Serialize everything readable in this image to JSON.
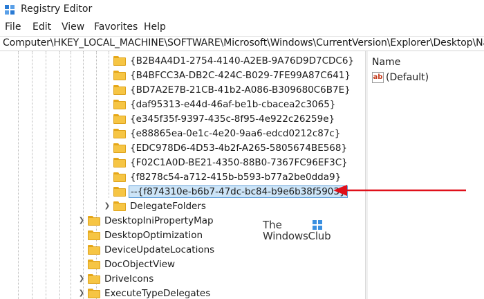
{
  "window": {
    "title": "Registry Editor"
  },
  "menu": [
    "File",
    "Edit",
    "View",
    "Favorites",
    "Help"
  ],
  "address": "Computer\\HKEY_LOCAL_MACHINE\\SOFTWARE\\Microsoft\\Windows\\CurrentVersion\\Explorer\\Desktop\\NameSpace",
  "tree": {
    "subkeys": [
      "{B2B4A4D1-2754-4140-A2EB-9A76D9D7CDC6}",
      "{B4BFCC3A-DB2C-424C-B029-7FE99A87C641}",
      "{BD7A2E7B-21CB-41b2-A086-B309680C6B7E}",
      "{daf95313-e44d-46af-be1b-cbacea2c3065}",
      "{e345f35f-9397-435c-8f95-4e922c26259e}",
      "{e88865ea-0e1c-4e20-9aa6-edcd0212c87c}",
      "{EDC978D6-4D53-4b2f-A265-5805674BE568}",
      "{F02C1A0D-BE21-4350-88B0-7367FC96EF3C}",
      "{f8278c54-a712-415b-b593-b77a2be0dda9}",
      "--{f874310e-b6b7-47dc-bc84-b9e6b38f5903}"
    ],
    "selected_index": 9,
    "sibling": "DelegateFolders",
    "explorer_children": [
      "DesktopIniPropertyMap",
      "DesktopOptimization",
      "DeviceUpdateLocations",
      "DocObjectView",
      "DriveIcons",
      "ExecuteTypeDelegates"
    ],
    "explorer_children_expandable": [
      true,
      false,
      false,
      false,
      true,
      true
    ]
  },
  "values": {
    "column_name": "Name",
    "rows": [
      {
        "icon": "string-value-icon",
        "icon_text": "ab",
        "name": "(Default)"
      }
    ]
  },
  "watermark": {
    "line1": "The",
    "line2": "WindowsClub"
  },
  "colors": {
    "folder": "#f6c544",
    "selection": "#cce4f7",
    "selection_border": "#5a9bd8",
    "arrow": "#e0101a"
  }
}
